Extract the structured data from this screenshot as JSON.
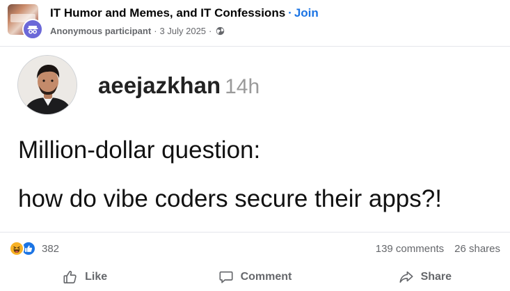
{
  "group": {
    "name": "IT Humor and Memes, and IT Confessions",
    "separator": "·",
    "join_label": "Join"
  },
  "post_meta": {
    "author": "Anonymous participant",
    "separator": "·",
    "date": "3 July 2025",
    "separator2": "·",
    "audience_icon": "globe-icon"
  },
  "content": {
    "handle": "aeejazkhan",
    "time": "14h",
    "line1": "Million-dollar question:",
    "line2": "how do vibe coders secure their apps?!"
  },
  "stats": {
    "reaction_icons": [
      "haha-reaction-icon",
      "like-reaction-icon"
    ],
    "reaction_count": "382",
    "comments": "139 comments",
    "shares": "26 shares"
  },
  "actions": {
    "like_label": "Like",
    "comment_label": "Comment",
    "share_label": "Share"
  },
  "colors": {
    "accent": "#1b74e4",
    "muted": "#65676b",
    "anon_badge": "#6b68d8",
    "haha": "#f7b125",
    "like": "#1b74e4"
  }
}
